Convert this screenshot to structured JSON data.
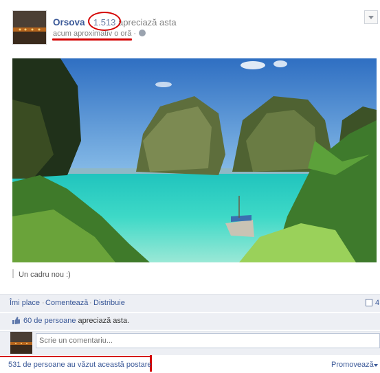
{
  "post": {
    "page_name": "Orsova",
    "separator": "·",
    "likes_count": "1.513",
    "likes_suffix": "apreciază asta",
    "timestamp": "acum aproximativ o oră",
    "timestamp_sep": "·",
    "caption": "Un cadru nou :)"
  },
  "actions": {
    "like": "Îmi place",
    "dot": "·",
    "comment": "Comentează",
    "share": "Distribuie",
    "share_count": "4"
  },
  "likes_row": {
    "count_text": "60 de persoane",
    "suffix": "apreciază asta."
  },
  "comment_box": {
    "placeholder": "Scrie un comentariu..."
  },
  "footer": {
    "views_text": "531 de persoane au văzut această postare",
    "promote_label": "Promovează"
  },
  "colors": {
    "link": "#3b5998",
    "annotation": "#d40000",
    "bar_bg": "#edeff4"
  },
  "icons": [
    "globe-icon",
    "menu-chevron-icon",
    "thumbs-up-icon",
    "share-icon",
    "promote-caret-icon"
  ]
}
